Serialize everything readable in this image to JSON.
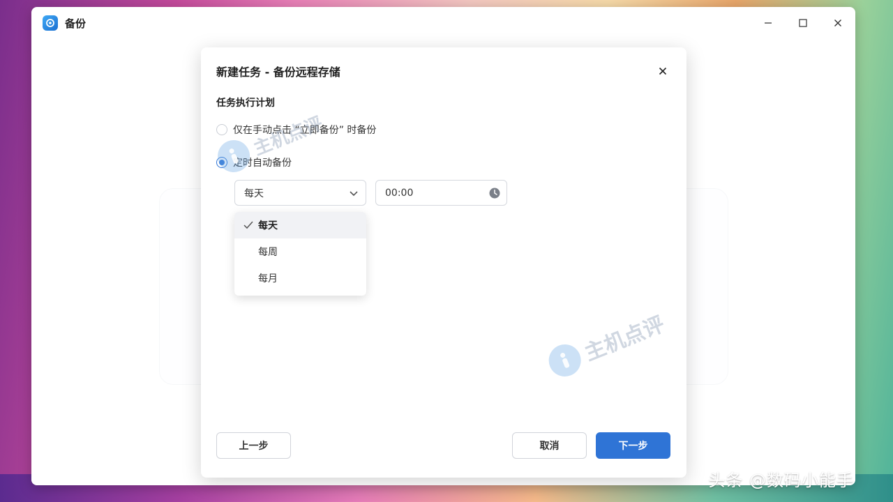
{
  "window": {
    "title": "备份",
    "app_icon": "backup-app-icon",
    "controls": [
      "minimize-icon",
      "maximize-icon",
      "close-icon"
    ]
  },
  "dialog": {
    "title": "新建任务 - 备份远程存储",
    "section_title": "任务执行计划",
    "options": [
      {
        "label": "仅在手动点击 “立即备份” 时备份",
        "checked": false
      },
      {
        "label": "定时自动备份",
        "checked": true
      }
    ],
    "frequency": {
      "selected": "每天",
      "options": [
        "每天",
        "每周",
        "每月"
      ]
    },
    "time": {
      "value": "00:00",
      "icon": "clock-icon"
    },
    "buttons": {
      "prev": "上一步",
      "cancel": "取消",
      "next": "下一步"
    }
  },
  "watermark": {
    "text": "主机点评"
  },
  "credit": "头条 @数码小能手",
  "colors": {
    "accent": "#2f74d6",
    "selected_bg": "#f1f2f5",
    "border": "#d5d8de"
  }
}
